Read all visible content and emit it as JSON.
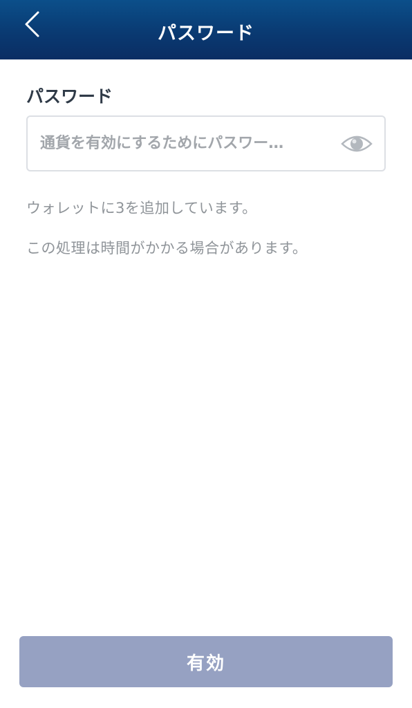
{
  "header": {
    "title": "パスワード",
    "back_icon": "chevron-left-icon"
  },
  "form": {
    "label": "パスワード",
    "input": {
      "value": "",
      "placeholder": "通貨を有効にするためにパスワー…",
      "toggle_icon": "eye-icon"
    }
  },
  "info": {
    "line1": "ウォレットに3を追加しています。",
    "line2": "この処理は時間がかかる場合があります。"
  },
  "actions": {
    "submit_label": "有効"
  },
  "colors": {
    "header_top": "#0b4f8a",
    "header_bottom": "#0b2d63",
    "button_bg": "#96a1c2",
    "label_text": "#2f3a47",
    "muted_text": "#8f9499"
  }
}
